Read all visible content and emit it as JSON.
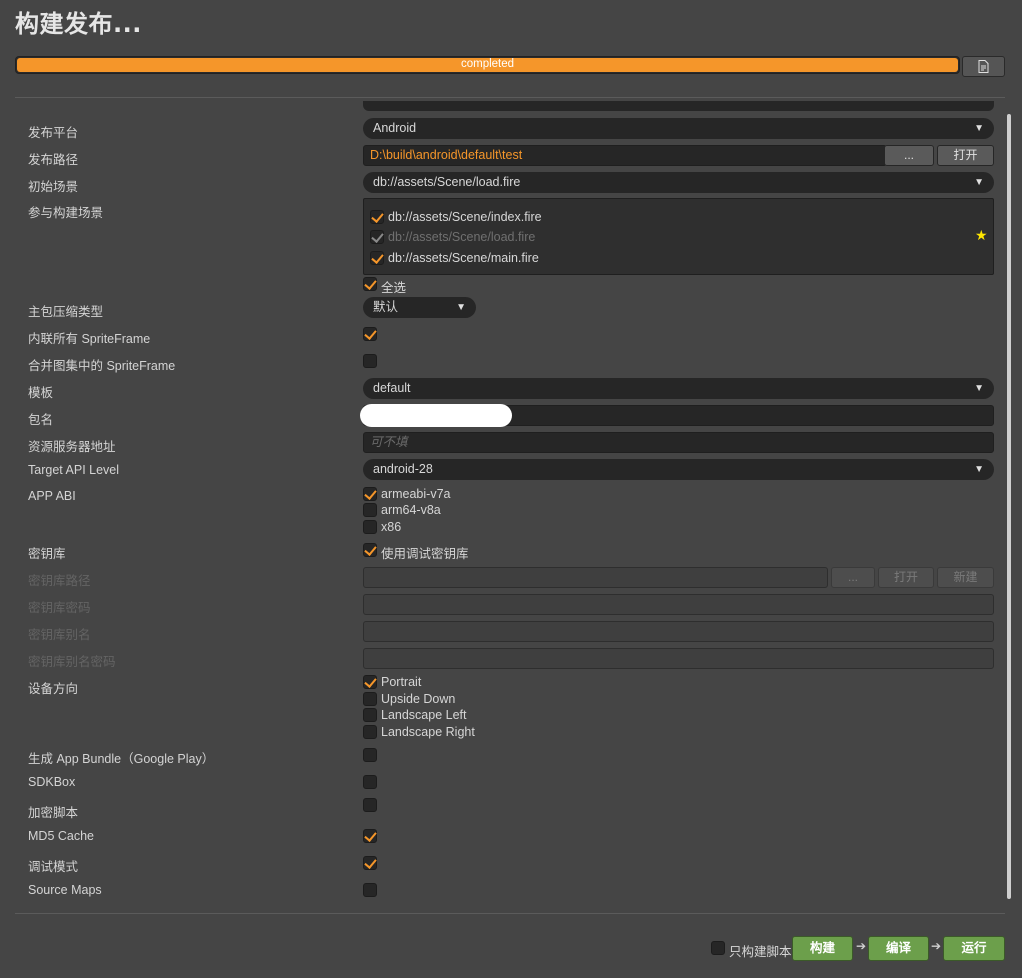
{
  "title": "构建发布...",
  "progress": {
    "label": "completed",
    "percent": 100
  },
  "labels": {
    "platform": "发布平台",
    "build_path": "发布路径",
    "start_scene": "初始场景",
    "included_scenes": "参与构建场景",
    "compression": "主包压缩类型",
    "inline_spriteframe": "内联所有 SpriteFrame",
    "merge_spriteframe": "合并图集中的 SpriteFrame",
    "template": "模板",
    "package_name": "包名",
    "resource_server": "资源服务器地址",
    "api_level": "Target API Level",
    "app_abi": "APP ABI",
    "keystore": "密钥库",
    "keystore_path": "密钥库路径",
    "keystore_password": "密钥库密码",
    "keystore_alias": "密钥库别名",
    "keystore_alias_password": "密钥库别名密码",
    "orientation": "设备方向",
    "app_bundle": "生成 App Bundle（Google Play）",
    "sdkbox": "SDKBox",
    "encrypt_js": "加密脚本",
    "md5_cache": "MD5 Cache",
    "debug": "调试模式",
    "source_maps": "Source Maps"
  },
  "values": {
    "platform": "Android",
    "build_path": "D:\\build\\android\\default\\test",
    "start_scene": "db://assets/Scene/load.fire",
    "compression": "默认",
    "template": "default",
    "resource_server_placeholder": "可不填",
    "api_level": "android-28"
  },
  "buttons": {
    "browse": "...",
    "open": "打开",
    "keystore_browse": "...",
    "keystore_open": "打开",
    "keystore_new": "新建",
    "build": "构建",
    "compile": "编译",
    "run": "运行"
  },
  "scenes": [
    {
      "path": "db://assets/Scene/index.fire",
      "checked": true,
      "disabled": false
    },
    {
      "path": "db://assets/Scene/load.fire",
      "checked": true,
      "disabled": true
    },
    {
      "path": "db://assets/Scene/main.fire",
      "checked": true,
      "disabled": false
    }
  ],
  "select_all": "全选",
  "abis": [
    {
      "name": "armeabi-v7a",
      "checked": true
    },
    {
      "name": "arm64-v8a",
      "checked": false
    },
    {
      "name": "x86",
      "checked": false
    }
  ],
  "use_debug_keystore": "使用调试密钥库",
  "orientations": [
    {
      "name": "Portrait",
      "checked": true
    },
    {
      "name": "Upside Down",
      "checked": false
    },
    {
      "name": "Landscape Left",
      "checked": false
    },
    {
      "name": "Landscape Right",
      "checked": false
    }
  ],
  "checks": {
    "inline_spriteframe": true,
    "merge_spriteframe": false,
    "app_bundle": false,
    "sdkbox": false,
    "encrypt_js": false,
    "md5_cache": true,
    "debug": true,
    "source_maps": false
  },
  "build_script_only": "只构建脚本",
  "colors": {
    "accent": "#f5962a",
    "action_green": "#6c9f4b",
    "background": "#454545",
    "field": "#262626"
  }
}
